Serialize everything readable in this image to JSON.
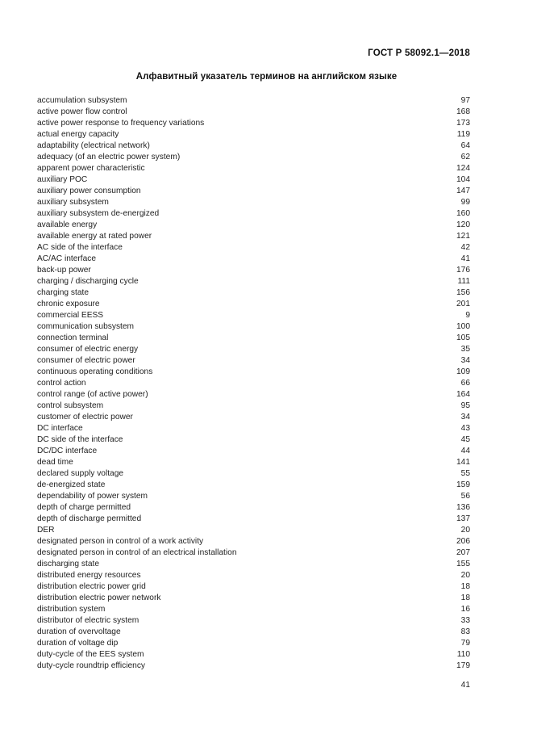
{
  "header": {
    "standard_code": "ГОСТ Р 58092.1—2018"
  },
  "title": "Алфавитный указатель терминов на английском языке",
  "footer": {
    "page_number": "41"
  },
  "index": {
    "entries": [
      {
        "term": "accumulation subsystem",
        "page": "97"
      },
      {
        "term": "active power flow control",
        "page": "168"
      },
      {
        "term": "active power response to frequency variations",
        "page": "173"
      },
      {
        "term": "actual energy capacity",
        "page": "119"
      },
      {
        "term": "adaptability (electrical network)",
        "page": "64"
      },
      {
        "term": "adequacy (of an electric power system)",
        "page": "62"
      },
      {
        "term": "apparent power characteristic",
        "page": "124"
      },
      {
        "term": "auxiliary POC",
        "page": "104"
      },
      {
        "term": "auxiliary power consumption",
        "page": "147"
      },
      {
        "term": "auxiliary subsystem",
        "page": "99"
      },
      {
        "term": "auxiliary subsystem de-energized",
        "page": "160"
      },
      {
        "term": "available energy",
        "page": "120"
      },
      {
        "term": "available energy at rated power",
        "page": "121"
      },
      {
        "term": "AC side of the interface",
        "page": "42"
      },
      {
        "term": "AC/AC interface",
        "page": "41"
      },
      {
        "term": "back-up power",
        "page": "176"
      },
      {
        "term": "charging / discharging cycle",
        "page": "111"
      },
      {
        "term": "charging state",
        "page": "156"
      },
      {
        "term": "chronic exposure",
        "page": "201"
      },
      {
        "term": "commercial EESS",
        "page": "9"
      },
      {
        "term": "communication subsystem",
        "page": "100"
      },
      {
        "term": "connection terminal",
        "page": "105"
      },
      {
        "term": "consumer of electric energy",
        "page": "35"
      },
      {
        "term": "consumer of electric power",
        "page": "34"
      },
      {
        "term": "continuous operating conditions",
        "page": "109"
      },
      {
        "term": "control action",
        "page": "66"
      },
      {
        "term": "control range (of active power)",
        "page": "164"
      },
      {
        "term": "control subsystem",
        "page": "95"
      },
      {
        "term": "customer of electric power",
        "page": "34"
      },
      {
        "term": "DC interface",
        "page": "43"
      },
      {
        "term": "DC side of the interface",
        "page": "45"
      },
      {
        "term": "DC/DC interface",
        "page": "44"
      },
      {
        "term": "dead time",
        "page": "141"
      },
      {
        "term": "declared supply voltage",
        "page": "55"
      },
      {
        "term": "de-energized state",
        "page": "159"
      },
      {
        "term": "dependability of power system",
        "page": "56"
      },
      {
        "term": "depth of charge permitted",
        "page": "136"
      },
      {
        "term": "depth of discharge permitted",
        "page": "137"
      },
      {
        "term": "DER",
        "page": "20"
      },
      {
        "term": "designated person in control of a work activity",
        "page": "206"
      },
      {
        "term": "designated person in control of an electrical installation",
        "page": "207"
      },
      {
        "term": "discharging state",
        "page": "155"
      },
      {
        "term": "distributed energy resources",
        "page": "20"
      },
      {
        "term": "distribution electric power grid",
        "page": "18"
      },
      {
        "term": "distribution electric power network",
        "page": "18"
      },
      {
        "term": "distribution system",
        "page": "16"
      },
      {
        "term": "distributor of electric system",
        "page": "33"
      },
      {
        "term": "duration of overvoltage",
        "page": "83"
      },
      {
        "term": "duration of voltage dip",
        "page": "79"
      },
      {
        "term": "duty-cycle of the EES system",
        "page": "110"
      },
      {
        "term": "duty-cycle roundtrip efficiency",
        "page": "179"
      }
    ]
  }
}
